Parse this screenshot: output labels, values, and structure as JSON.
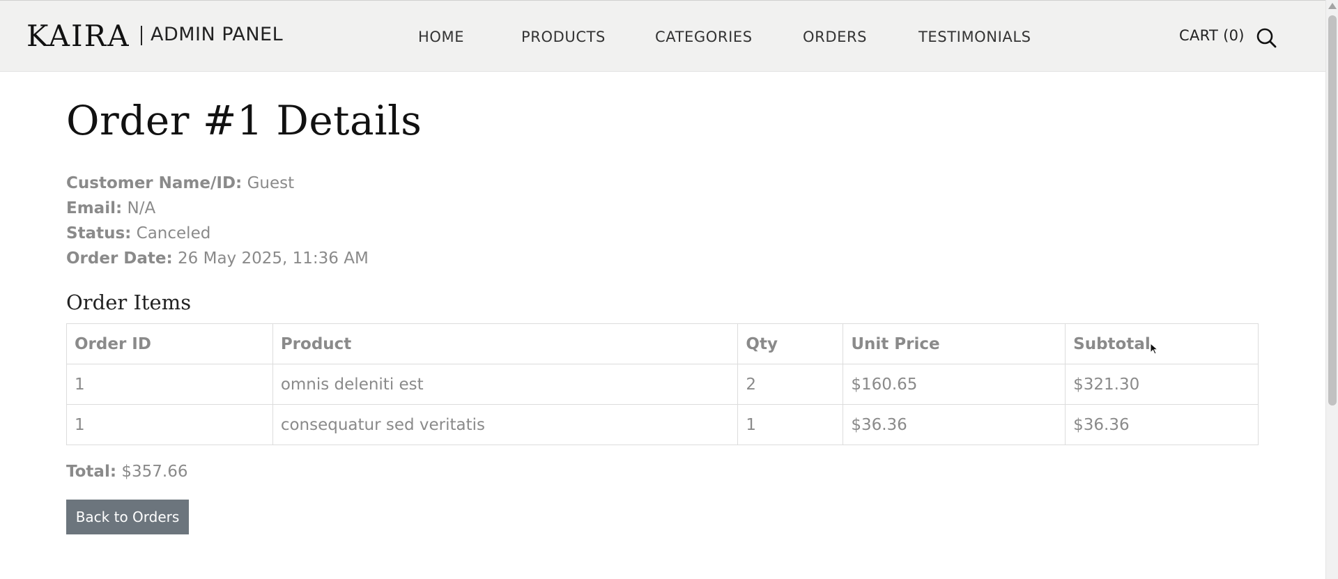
{
  "header": {
    "logo": "KAIRA",
    "subtitle": "ADMIN PANEL",
    "nav": [
      {
        "label": "HOME"
      },
      {
        "label": "PRODUCTS"
      },
      {
        "label": "CATEGORIES"
      },
      {
        "label": "ORDERS"
      },
      {
        "label": "TESTIMONIALS"
      }
    ],
    "cart_label": "CART (0)",
    "search_icon": "search-icon"
  },
  "page": {
    "title": "Order #1 Details",
    "details": [
      {
        "label": "Customer Name/ID:",
        "value": "Guest"
      },
      {
        "label": "Email:",
        "value": "N/A"
      },
      {
        "label": "Status:",
        "value": "Canceled"
      },
      {
        "label": "Order Date:",
        "value": "26 May 2025, 11:36 AM"
      }
    ],
    "items_title": "Order Items",
    "table": {
      "columns": [
        "Order ID",
        "Product",
        "Qty",
        "Unit Price",
        "Subtotal"
      ],
      "rows": [
        [
          "1",
          "omnis deleniti est",
          "2",
          "$160.65",
          "$321.30"
        ],
        [
          "1",
          "consequatur sed veritatis",
          "1",
          "$36.36",
          "$36.36"
        ]
      ]
    },
    "total_label": "Total:",
    "total_value": "$357.66",
    "back_button": "Back to Orders"
  },
  "colors": {
    "header_bg": "#f1f1f0",
    "button_bg": "#6c757d",
    "text_muted": "#8a8a8a",
    "text_dark": "#111111"
  }
}
